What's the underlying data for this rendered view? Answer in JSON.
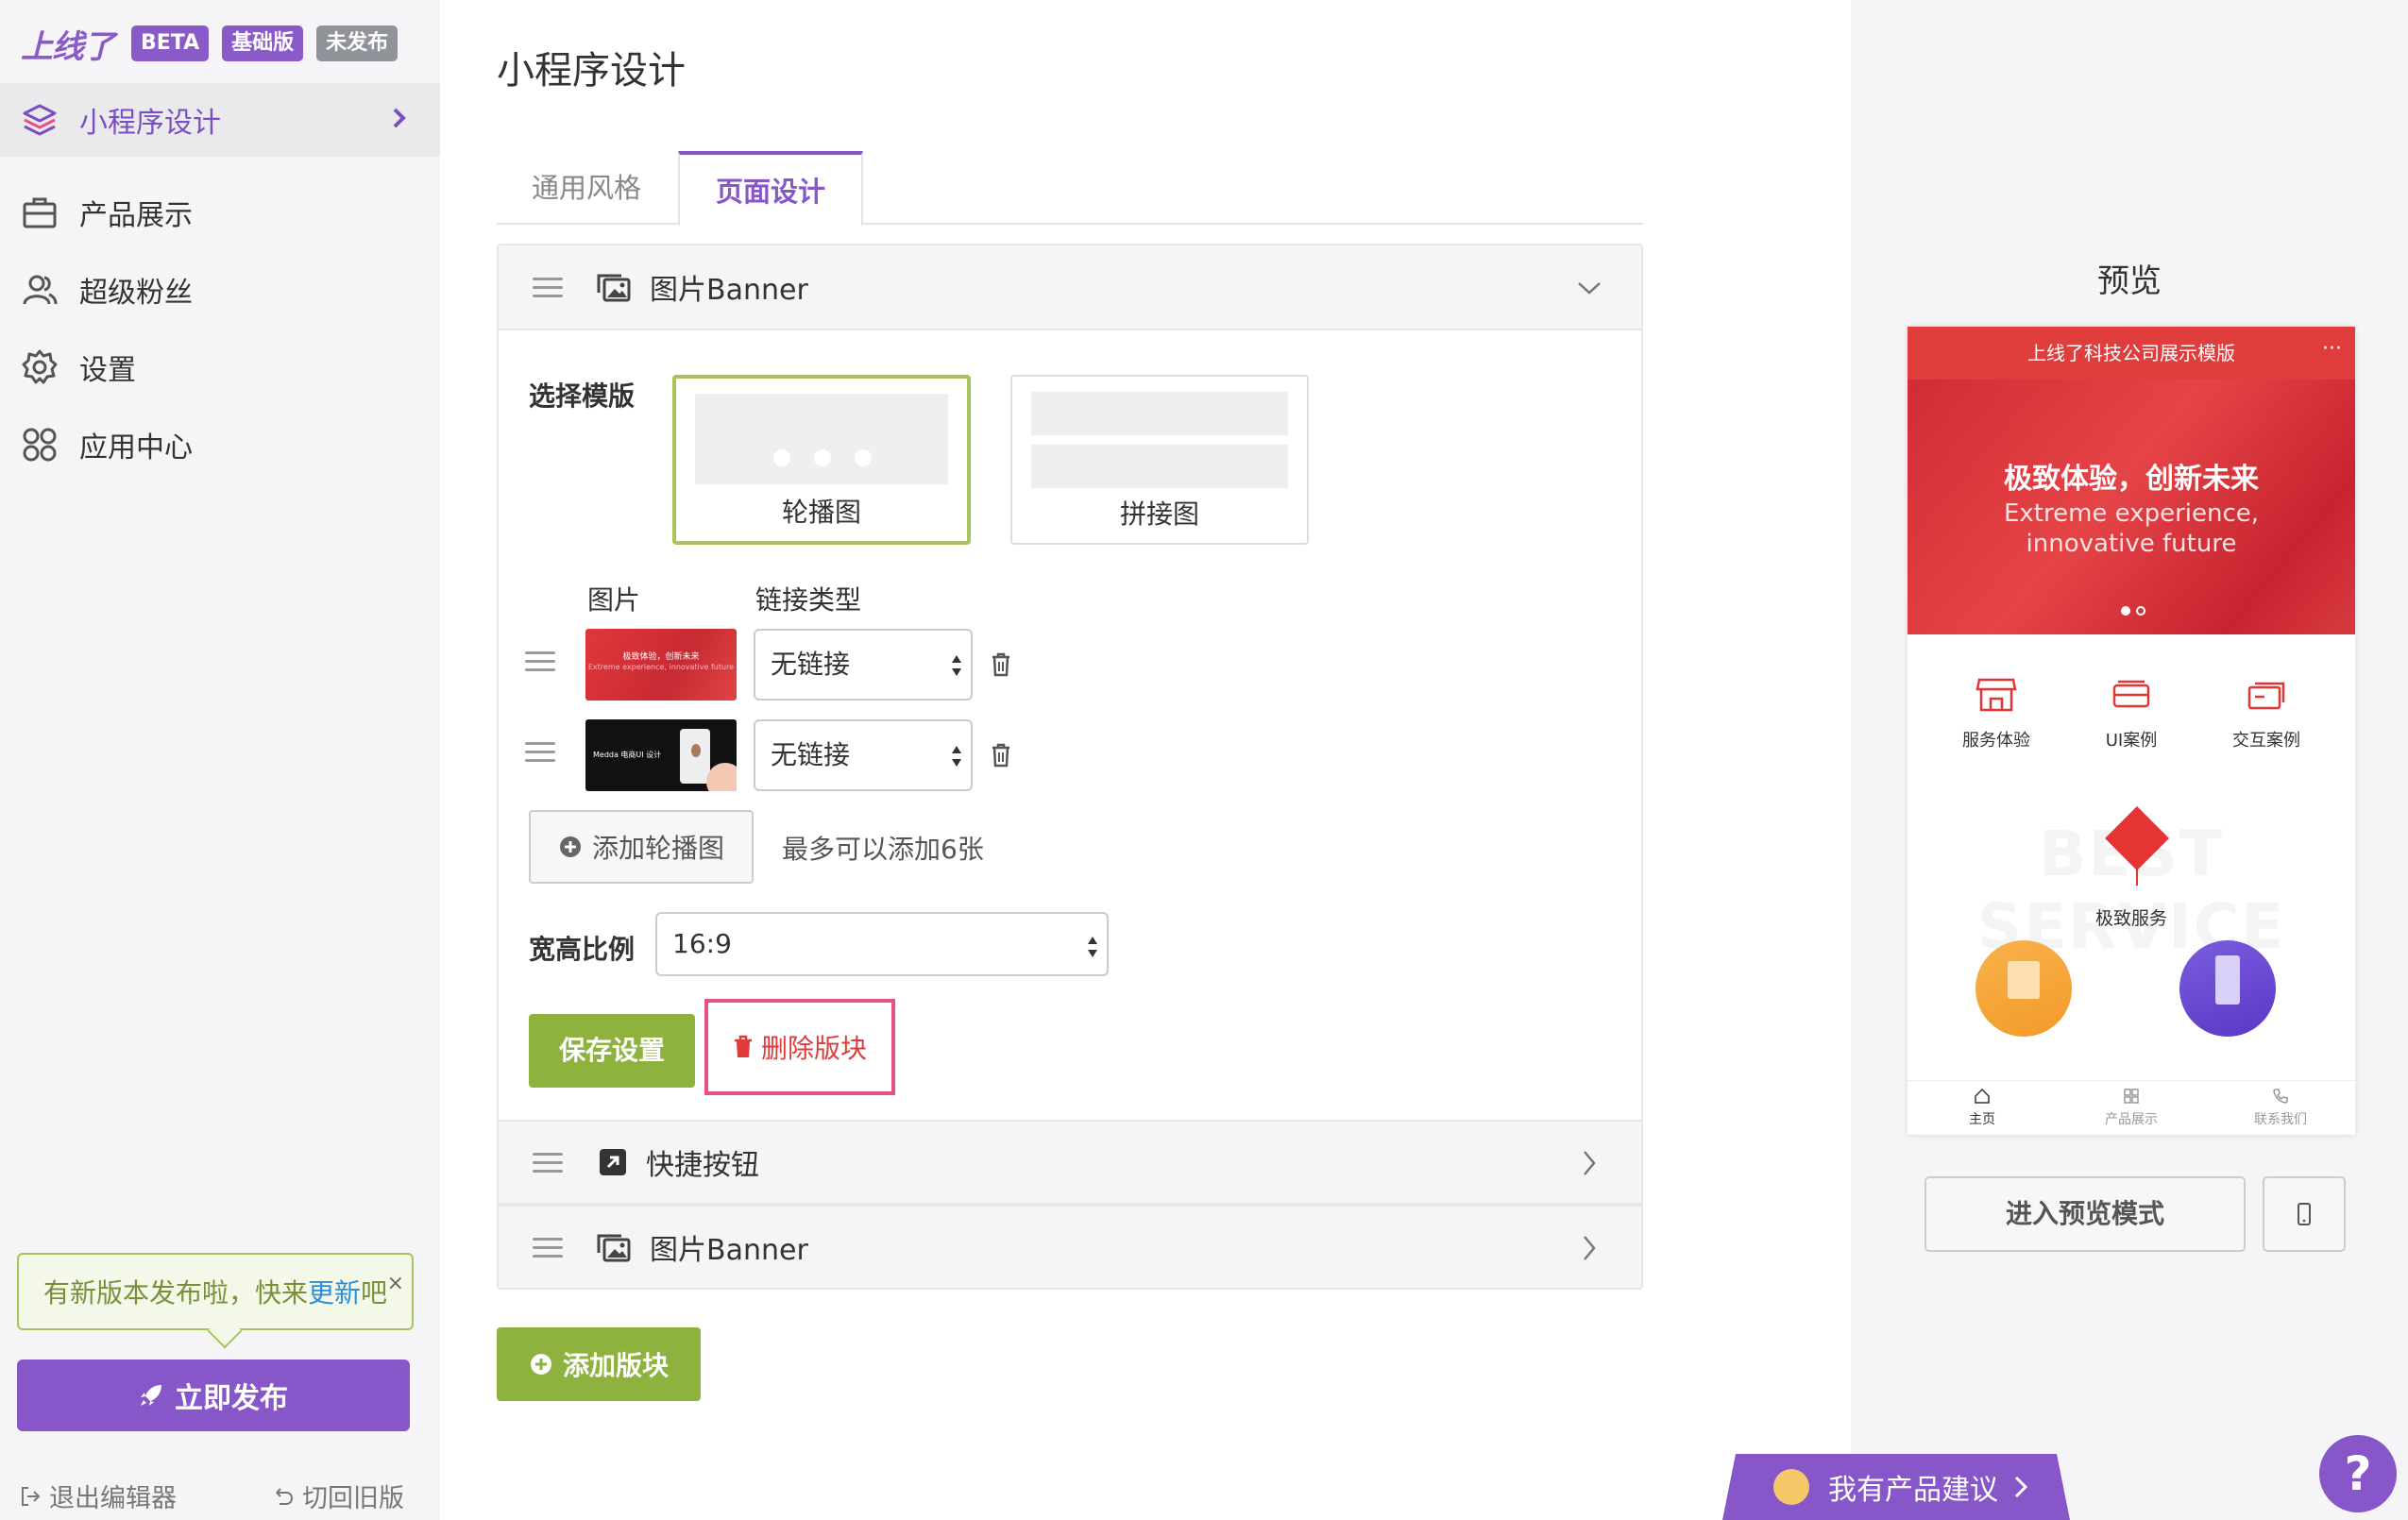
{
  "brand": {
    "logo": "上线了",
    "tags": [
      "BETA",
      "基础版",
      "未发布"
    ]
  },
  "sidebar": {
    "active_item": "小程序设计",
    "items": [
      {
        "label": "产品展示",
        "icon": "briefcase-icon"
      },
      {
        "label": "超级粉丝",
        "icon": "users-icon"
      },
      {
        "label": "设置",
        "icon": "gear-icon"
      },
      {
        "label": "应用中心",
        "icon": "apps-icon"
      }
    ],
    "notice": {
      "text": "有新版本发布啦，快来",
      "link": "更新",
      "suffix": "吧",
      "close": "×"
    },
    "publish_label": "立即发布",
    "exit_label": "退出编辑器",
    "old_label": "切回旧版"
  },
  "main": {
    "title": "小程序设计",
    "tabs": [
      "通用风格",
      "页面设计"
    ],
    "active_tab": "页面设计",
    "sections": [
      "图片Banner",
      "快捷按钮",
      "图片Banner"
    ],
    "template_label": "选择模版",
    "templates": [
      "轮播图",
      "拼接图"
    ],
    "col_image": "图片",
    "col_link": "链接类型",
    "rows": [
      {
        "thumb_title": "极致体验，创新未来",
        "thumb_sub": "Extreme experience, innovative future",
        "link": "无链接"
      },
      {
        "thumb_title": "Medda 电商UI 设计",
        "link": "无链接"
      }
    ],
    "add_slide_label": "添加轮播图",
    "add_hint": "最多可以添加6张",
    "ratio_label": "宽高比例",
    "ratio_value": "16:9",
    "save_label": "保存设置",
    "delete_label": "删除版块",
    "add_block_label": "添加版块"
  },
  "preview": {
    "title": "预览",
    "phone_title": "上线了科技公司展示模版",
    "banner_h1": "极致体验，创新未来",
    "banner_h2": "Extreme experience, innovative future",
    "icons": [
      "服务体验",
      "UI案例",
      "交互案例"
    ],
    "watermark": "BEST SERVICE",
    "service": "极致服务",
    "tabbar": [
      "主页",
      "产品展示",
      "联系我们"
    ],
    "enter_label": "进入预览模式"
  },
  "widgets": {
    "suggest_label": "我有产品建议",
    "help_label": "?"
  },
  "colors": {
    "accent": "#8757c9",
    "green": "#8db33e",
    "danger": "#e03b3b",
    "phone_red": "#e03d3d"
  }
}
